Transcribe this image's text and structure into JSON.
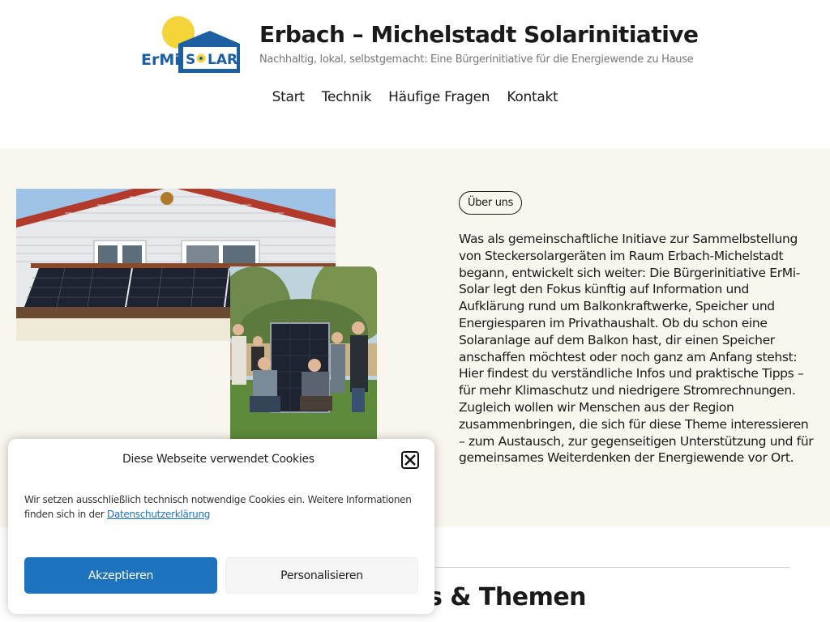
{
  "header": {
    "logo_text": "ErMi SOLAR",
    "site_title": "Erbach – Michelstadt Solarinitiative",
    "tagline": "Nachhaltig, lokal, selbstgemacht: Eine Bürgerinitiative für die Energiewende zu Hause"
  },
  "nav": {
    "items": [
      {
        "label": "Start"
      },
      {
        "label": "Technik"
      },
      {
        "label": "Häufige Fragen"
      },
      {
        "label": "Kontakt"
      }
    ]
  },
  "about": {
    "tag": "Über uns",
    "text": "Was als gemeinschaftliche Initiave zur Sammelbstellung von Steckersolargeräten im Raum Erbach-Michelstadt begann, entwickelt sich weiter: Die Bürgerinitiative ErMi-Solar legt den Fokus künftig auf Information und Aufklärung rund um Balkonkraftwerke, Speicher und Energiesparen im Privathaushalt. Ob du schon eine Solaranlage auf dem Balkon hast, dir einen Speicher anschaffen möchtest oder noch ganz am Anfang stehst: Hier findest du verständliche Infos und praktische Tipps – für mehr Klimaschutz und niedrigere Stromrechnungen. Zugleich wollen wir Menschen aus der Region zusammenbringen, die sich für diese Theme interessieren – zum Austausch, zur gegenseitigen Unterstützung und für gemeinsames Weiterdenken der Energiewende vor Ort."
  },
  "section": {
    "heading_partial": "s & Themen"
  },
  "cookie": {
    "title": "Diese Webseite verwendet Cookies",
    "text": "Wir setzen ausschließlich technisch notwendige Cookies ein. Weitere Informationen finden sich in der ",
    "link": "Datenschutzerklärung",
    "accept": "Akzeptieren",
    "customize": "Personalisieren"
  },
  "colors": {
    "accent_blue": "#1e73be",
    "logo_blue": "#1d5fa3",
    "logo_sun": "#f5d43a",
    "about_bg": "#f8f6ee"
  }
}
